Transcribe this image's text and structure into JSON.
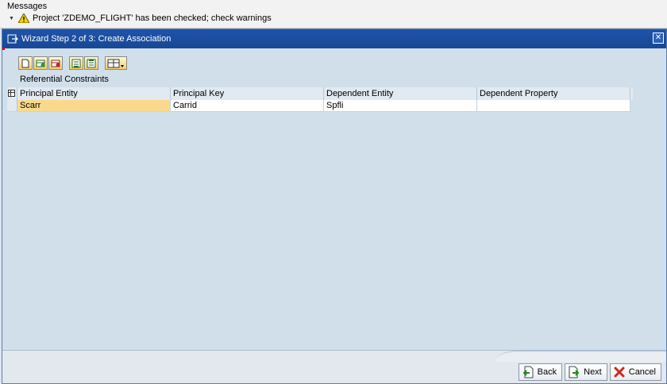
{
  "messages": {
    "title": "Messages",
    "warning_text": "Project 'ZDEMO_FLIGHT' has been checked; check warnings"
  },
  "dialog": {
    "title": "Wizard Step 2 of 3: Create Association",
    "section_label": "Referential Constraints",
    "table": {
      "columns": [
        "Principal Entity",
        "Principal Key",
        "Dependent Entity",
        "Dependent Property"
      ],
      "rows": [
        [
          "Scarr",
          "Carrid",
          "Spfli",
          ""
        ]
      ]
    },
    "buttons": {
      "back": "Back",
      "next": "Next",
      "cancel": "Cancel"
    }
  },
  "colors": {
    "titlebar": "#1f54a8",
    "dialog_bg": "#d1dfea",
    "active_cell": "#fbd98c"
  }
}
